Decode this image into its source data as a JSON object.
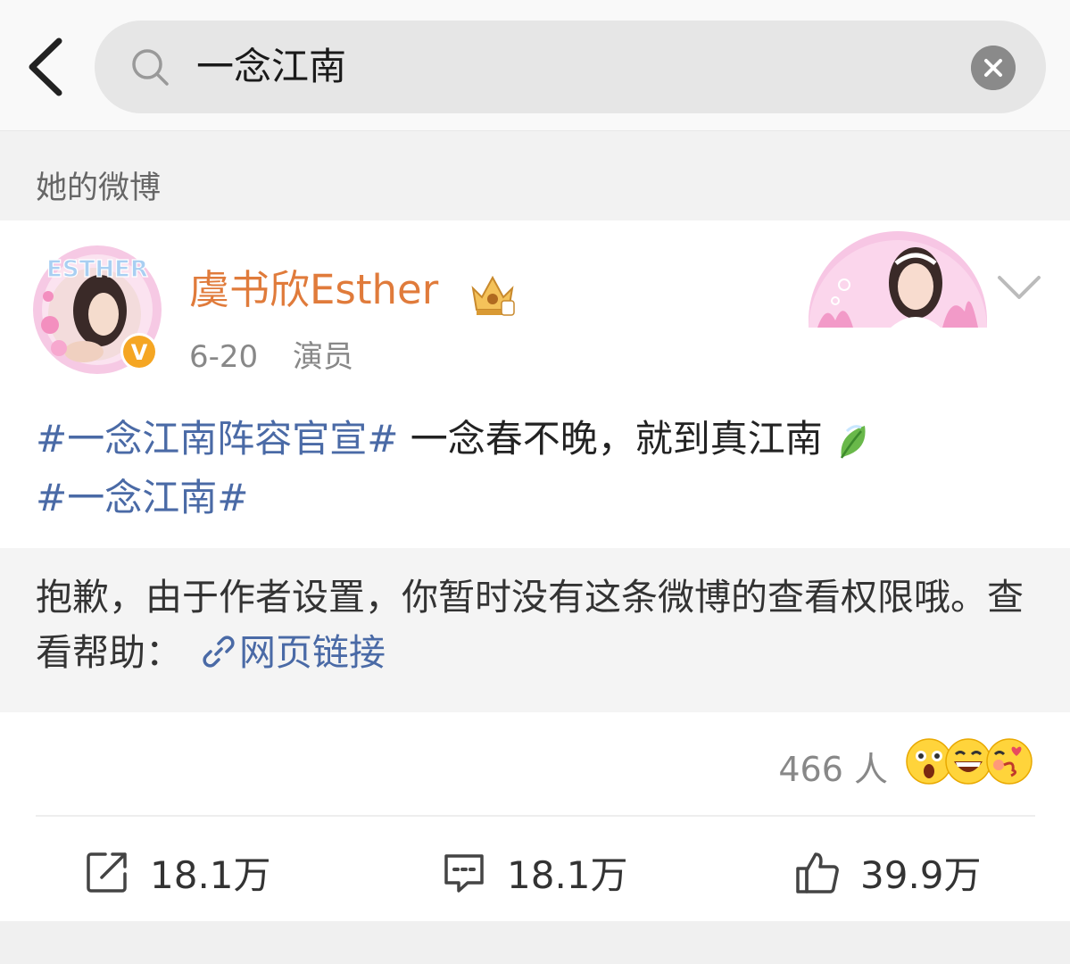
{
  "search": {
    "query": "一念江南"
  },
  "section": {
    "label": "她的微博"
  },
  "post": {
    "author": "虞书欣Esther",
    "avatar_text": "ESTHER",
    "verified_badge": "V",
    "date": "6-20",
    "role": "演员",
    "tag1": "#一念江南阵容官宣#",
    "text": " 一念春不晚，就到真江南",
    "tag2": "#一念江南#"
  },
  "notice": {
    "text": "抱歉，由于作者设置，你暂时没有这条微博的查看权限哦。查看帮助：",
    "link_label": "网页链接"
  },
  "reactions": {
    "count_label": "466 人"
  },
  "actions": {
    "repost": "18.1万",
    "comment": "18.1万",
    "like": "39.9万"
  },
  "colors": {
    "author": "#e07b3b",
    "tag": "#4a6aa6"
  }
}
